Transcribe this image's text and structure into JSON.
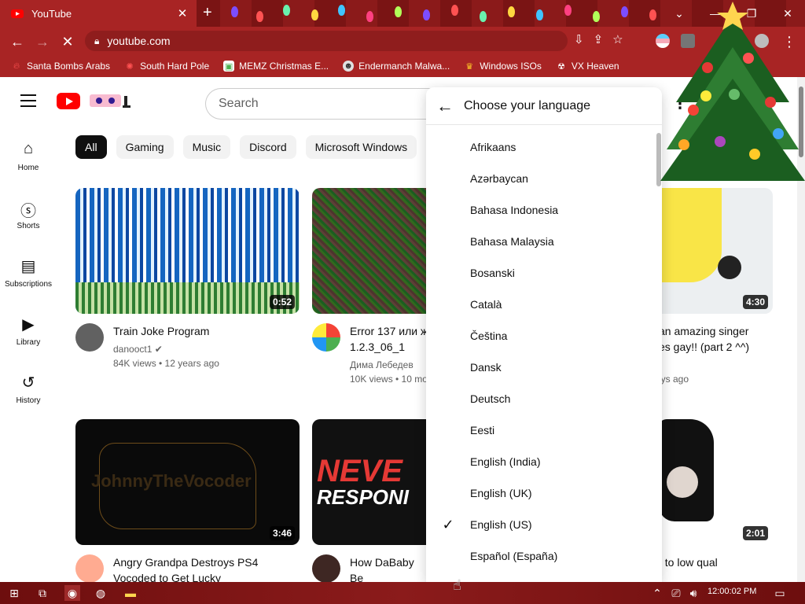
{
  "browser": {
    "tab_title": "YouTube",
    "url": "youtube.com",
    "bookmarks": [
      {
        "label": "Santa Bombs Arabs",
        "color": "#e53935"
      },
      {
        "label": "South Hard Pole",
        "color": "#c62828"
      },
      {
        "label": "MEMZ Christmas E...",
        "color": "#f5f5f5"
      },
      {
        "label": "Endermanch Malwa...",
        "color": "#9e9e9e"
      },
      {
        "label": "Windows ISOs",
        "color": "#ffca28"
      },
      {
        "label": "VX Heaven",
        "color": "#e0e0e0"
      }
    ]
  },
  "youtube": {
    "search_placeholder": "Search",
    "sidebar": [
      {
        "label": "Home",
        "icon": "home-icon",
        "glyph": "⌂"
      },
      {
        "label": "Shorts",
        "icon": "shorts-icon",
        "glyph": "ⓢ"
      },
      {
        "label": "Subscriptions",
        "icon": "subscriptions-icon",
        "glyph": "▤"
      },
      {
        "label": "Library",
        "icon": "library-icon",
        "glyph": "▶"
      },
      {
        "label": "History",
        "icon": "history-icon",
        "glyph": "↺"
      }
    ],
    "chips": [
      "All",
      "Gaming",
      "Music",
      "Discord",
      "Microsoft Windows"
    ],
    "videos": [
      {
        "title": "Train Joke Program",
        "channel": "danooct1",
        "verified": true,
        "stats": "84K views • 12 years ago",
        "duration": "0:52"
      },
      {
        "title": "Error 137 или ж\n1.2.3_06_1",
        "channel": "Дима Лебедев",
        "stats": "10K views • 10 mo",
        "duration": ""
      },
      {
        "title": "an amazing singer\nes gay!! (part 2 ^^)",
        "channel": "",
        "stats": "ays ago",
        "duration": "4:30"
      },
      {
        "title": "Angry Grandpa Destroys PS4\nVocoded to Get Lucky",
        "channel": "",
        "stats": "",
        "duration": "3:46"
      },
      {
        "title": "How DaBaby Be\nHated Rapper Ev",
        "channel": "",
        "stats": "",
        "duration": "",
        "thumb_text_1": "NEVE",
        "thumb_text_2": "RESPONI"
      },
      {
        "title": "t to low qual",
        "channel": "",
        "stats": "",
        "duration": "2:01"
      }
    ],
    "thumb_watermark": "JohnnyTheVocoder"
  },
  "language_menu": {
    "title": "Choose your language",
    "selected": "English (US)",
    "languages": [
      "Afrikaans",
      "Azərbaycan",
      "Bahasa Indonesia",
      "Bahasa Malaysia",
      "Bosanski",
      "Català",
      "Čeština",
      "Dansk",
      "Deutsch",
      "Eesti",
      "English (India)",
      "English (UK)",
      "English (US)",
      "Español (España)"
    ]
  },
  "taskbar": {
    "clock": "12:00:02 PM"
  }
}
